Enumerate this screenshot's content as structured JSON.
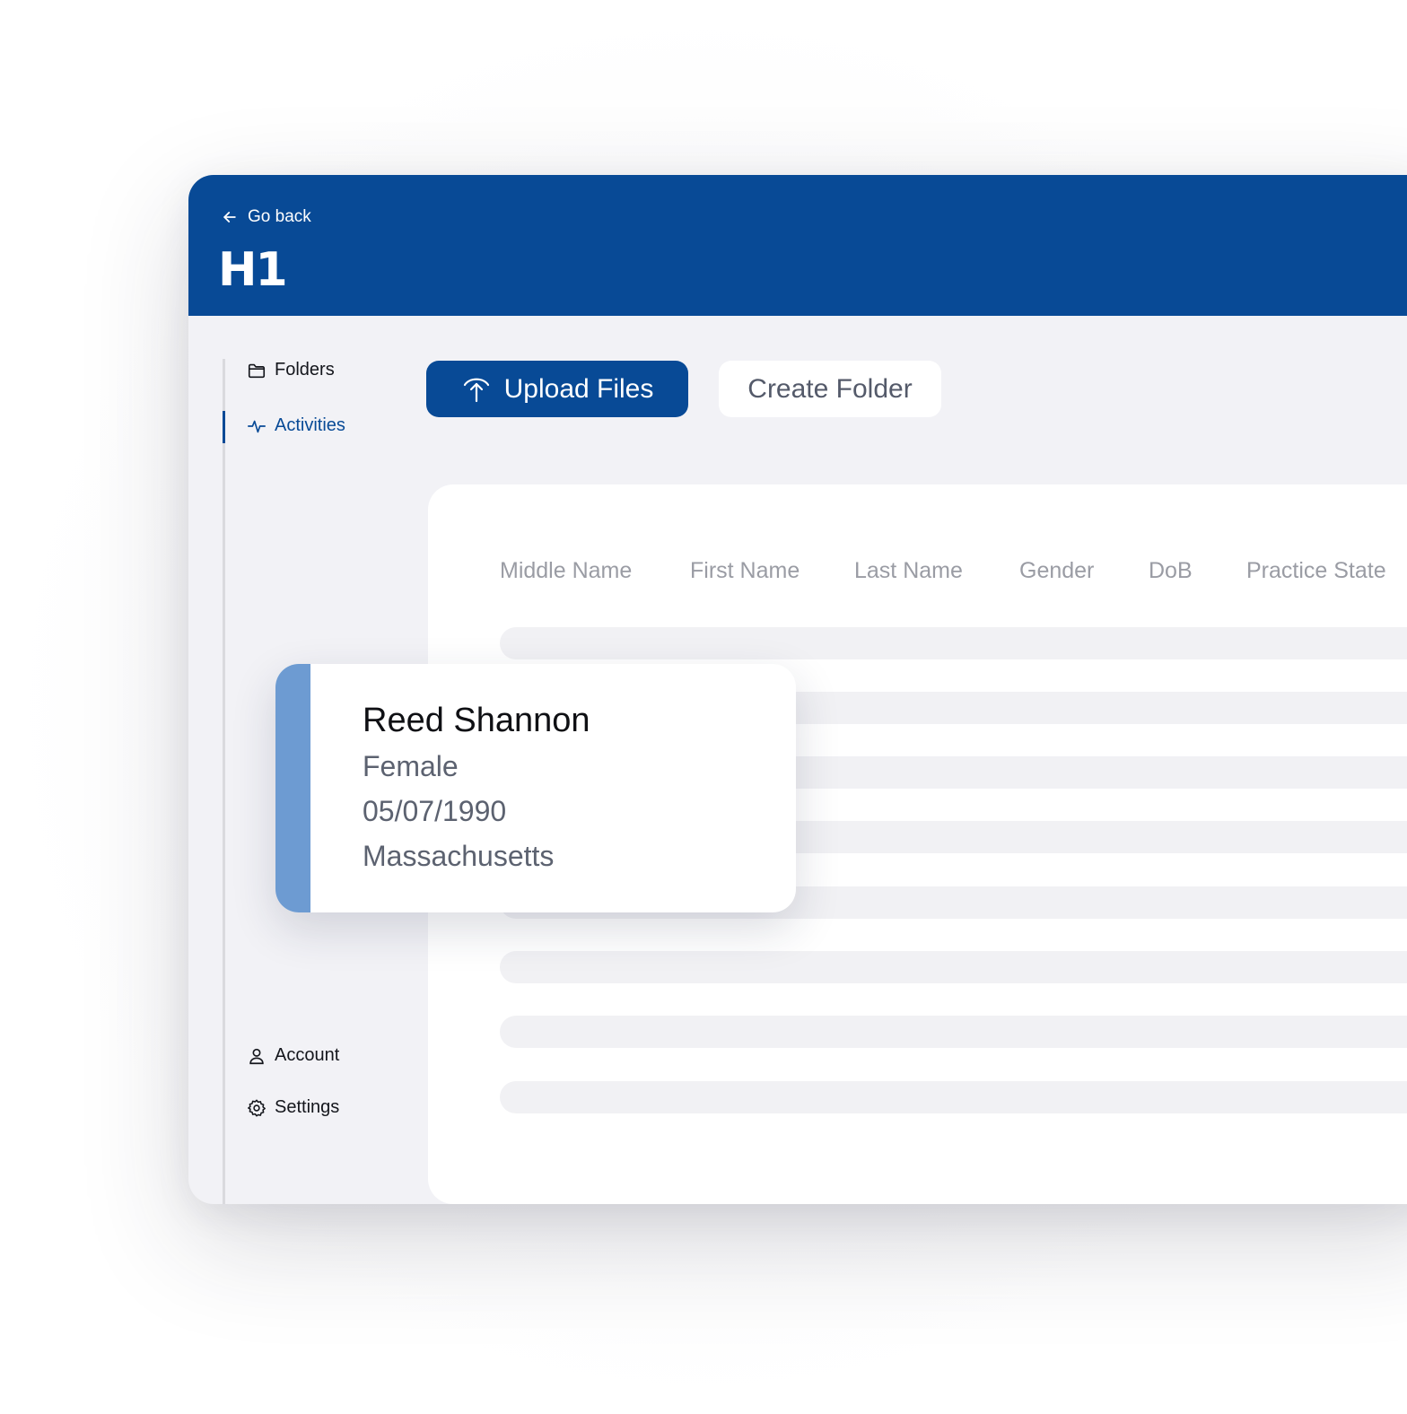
{
  "header": {
    "go_back_label": "Go back",
    "logo_text": "H1",
    "background_color": "#084a96"
  },
  "sidebar": {
    "items": [
      {
        "label": "Folders",
        "icon": "folder-icon",
        "active": false
      },
      {
        "label": "Activities",
        "icon": "activity-icon",
        "active": true
      },
      {
        "label": "Account",
        "icon": "user-icon",
        "active": false
      },
      {
        "label": "Settings",
        "icon": "gear-icon",
        "active": false
      }
    ]
  },
  "toolbar": {
    "upload_label": "Upload Files",
    "upload_icon": "upload-icon",
    "create_folder_label": "Create Folder"
  },
  "table": {
    "columns": [
      "Middle Name",
      "First Name",
      "Last Name",
      "Gender",
      "DoB",
      "Practice State"
    ]
  },
  "profile_card": {
    "name": "Reed Shannon",
    "gender": "Female",
    "dob": "05/07/1990",
    "state": "Massachusetts",
    "accent_color": "#6d9bd2"
  }
}
